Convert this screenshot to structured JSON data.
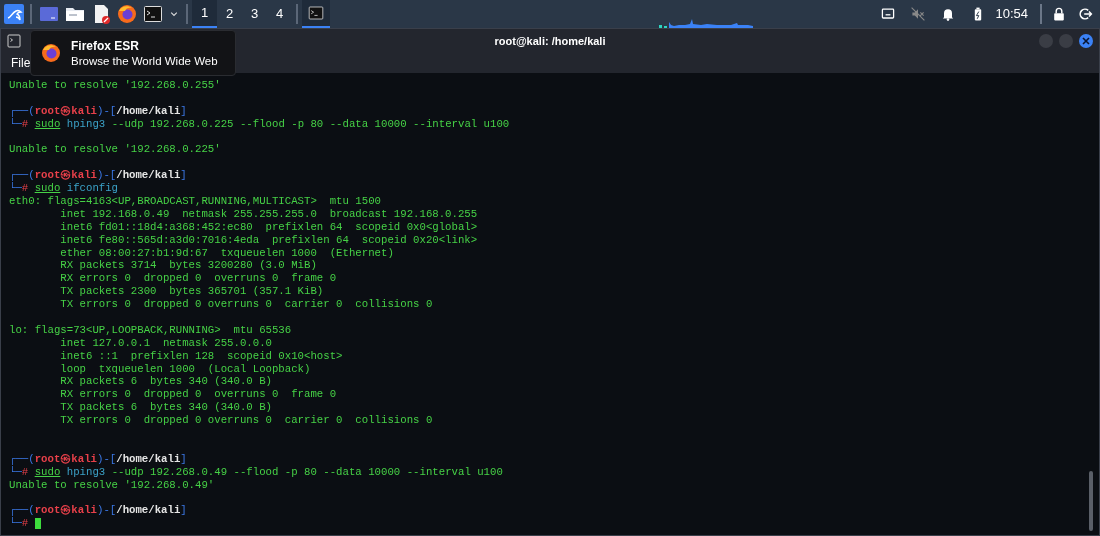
{
  "taskbar": {
    "launchers": [
      {
        "kind": "menu"
      },
      {
        "kind": "desktop"
      },
      {
        "kind": "files"
      },
      {
        "kind": "editor"
      },
      {
        "kind": "browser"
      },
      {
        "kind": "terminal"
      },
      {
        "kind": "dropdown"
      }
    ],
    "workspaces": [
      {
        "label": "1",
        "selected": true
      },
      {
        "label": "2",
        "selected": false
      },
      {
        "label": "3",
        "selected": false
      },
      {
        "label": "4",
        "selected": false
      }
    ],
    "tasks": [
      {
        "kind": "terminal",
        "selected": true
      }
    ],
    "tray": [
      {
        "kind": "display"
      },
      {
        "kind": "muted"
      },
      {
        "kind": "bell"
      },
      {
        "kind": "battery"
      }
    ],
    "clock": "10:54",
    "session": [
      {
        "kind": "lock"
      },
      {
        "kind": "logout"
      }
    ]
  },
  "window": {
    "title": "root@kali: /home/kali",
    "menu": [
      "File"
    ]
  },
  "tooltip": {
    "title": "Firefox ESR",
    "subtitle": "Browse the World Wide Web"
  },
  "terminal": {
    "lines": [
      {
        "kind": "text",
        "segments": [
          {
            "kind": "out",
            "text": "Unable to resolve '192.268.0.255'"
          }
        ]
      },
      {
        "kind": "blank"
      },
      {
        "kind": "text",
        "segments": [
          {
            "kind": "frame",
            "text": "┌──("
          },
          {
            "kind": "user",
            "text": "root㉿kali"
          },
          {
            "kind": "frame",
            "text": ")-["
          },
          {
            "kind": "path",
            "text": "/home/kali"
          },
          {
            "kind": "frame",
            "text": "]"
          }
        ]
      },
      {
        "kind": "text",
        "segments": [
          {
            "kind": "frame",
            "text": "└─"
          },
          {
            "kind": "hash",
            "text": "# "
          },
          {
            "kind": "sudo",
            "text": "sudo"
          },
          {
            "kind": "prog",
            "text": " hping3"
          },
          {
            "kind": "arg",
            "text": " --udp 192.268.0.225 --flood -p 80 --data 10000 --interval u100"
          }
        ]
      },
      {
        "kind": "blank"
      },
      {
        "kind": "text",
        "segments": [
          {
            "kind": "out",
            "text": "Unable to resolve '192.268.0.225'"
          }
        ]
      },
      {
        "kind": "blank"
      },
      {
        "kind": "text",
        "segments": [
          {
            "kind": "frame",
            "text": "┌──("
          },
          {
            "kind": "user",
            "text": "root㉿kali"
          },
          {
            "kind": "frame",
            "text": ")-["
          },
          {
            "kind": "path",
            "text": "/home/kali"
          },
          {
            "kind": "frame",
            "text": "]"
          }
        ]
      },
      {
        "kind": "text",
        "segments": [
          {
            "kind": "frame",
            "text": "└─"
          },
          {
            "kind": "hash",
            "text": "# "
          },
          {
            "kind": "sudo",
            "text": "sudo"
          },
          {
            "kind": "prog",
            "text": " ifconfig"
          }
        ]
      },
      {
        "kind": "text",
        "segments": [
          {
            "kind": "out",
            "text": "eth0: flags=4163<UP,BROADCAST,RUNNING,MULTICAST>  mtu 1500"
          }
        ]
      },
      {
        "kind": "text",
        "segments": [
          {
            "kind": "out",
            "text": "        inet 192.168.0.49  netmask 255.255.255.0  broadcast 192.168.0.255"
          }
        ]
      },
      {
        "kind": "text",
        "segments": [
          {
            "kind": "out",
            "text": "        inet6 fd01::18d4:a368:452:ec80  prefixlen 64  scopeid 0x0<global>"
          }
        ]
      },
      {
        "kind": "text",
        "segments": [
          {
            "kind": "out",
            "text": "        inet6 fe80::565d:a3d0:7016:4eda  prefixlen 64  scopeid 0x20<link>"
          }
        ]
      },
      {
        "kind": "text",
        "segments": [
          {
            "kind": "out",
            "text": "        ether 08:00:27:b1:9d:67  txqueuelen 1000  (Ethernet)"
          }
        ]
      },
      {
        "kind": "text",
        "segments": [
          {
            "kind": "out",
            "text": "        RX packets 3714  bytes 3200280 (3.0 MiB)"
          }
        ]
      },
      {
        "kind": "text",
        "segments": [
          {
            "kind": "out",
            "text": "        RX errors 0  dropped 0  overruns 0  frame 0"
          }
        ]
      },
      {
        "kind": "text",
        "segments": [
          {
            "kind": "out",
            "text": "        TX packets 2300  bytes 365701 (357.1 KiB)"
          }
        ]
      },
      {
        "kind": "text",
        "segments": [
          {
            "kind": "out",
            "text": "        TX errors 0  dropped 0 overruns 0  carrier 0  collisions 0"
          }
        ]
      },
      {
        "kind": "blank"
      },
      {
        "kind": "text",
        "segments": [
          {
            "kind": "out",
            "text": "lo: flags=73<UP,LOOPBACK,RUNNING>  mtu 65536"
          }
        ]
      },
      {
        "kind": "text",
        "segments": [
          {
            "kind": "out",
            "text": "        inet 127.0.0.1  netmask 255.0.0.0"
          }
        ]
      },
      {
        "kind": "text",
        "segments": [
          {
            "kind": "out",
            "text": "        inet6 ::1  prefixlen 128  scopeid 0x10<host>"
          }
        ]
      },
      {
        "kind": "text",
        "segments": [
          {
            "kind": "out",
            "text": "        loop  txqueuelen 1000  (Local Loopback)"
          }
        ]
      },
      {
        "kind": "text",
        "segments": [
          {
            "kind": "out",
            "text": "        RX packets 6  bytes 340 (340.0 B)"
          }
        ]
      },
      {
        "kind": "text",
        "segments": [
          {
            "kind": "out",
            "text": "        RX errors 0  dropped 0  overruns 0  frame 0"
          }
        ]
      },
      {
        "kind": "text",
        "segments": [
          {
            "kind": "out",
            "text": "        TX packets 6  bytes 340 (340.0 B)"
          }
        ]
      },
      {
        "kind": "text",
        "segments": [
          {
            "kind": "out",
            "text": "        TX errors 0  dropped 0 overruns 0  carrier 0  collisions 0"
          }
        ]
      },
      {
        "kind": "blank"
      },
      {
        "kind": "blank"
      },
      {
        "kind": "text",
        "segments": [
          {
            "kind": "frame",
            "text": "┌──("
          },
          {
            "kind": "user",
            "text": "root㉿kali"
          },
          {
            "kind": "frame",
            "text": ")-["
          },
          {
            "kind": "path",
            "text": "/home/kali"
          },
          {
            "kind": "frame",
            "text": "]"
          }
        ]
      },
      {
        "kind": "text",
        "segments": [
          {
            "kind": "frame",
            "text": "└─"
          },
          {
            "kind": "hash",
            "text": "# "
          },
          {
            "kind": "sudo",
            "text": "sudo"
          },
          {
            "kind": "prog",
            "text": " hping3"
          },
          {
            "kind": "arg",
            "text": " --udp 192.268.0.49 --flood -p 80 --data 10000 --interval u100"
          }
        ]
      },
      {
        "kind": "text",
        "segments": [
          {
            "kind": "out",
            "text": "Unable to resolve '192.268.0.49'"
          }
        ]
      },
      {
        "kind": "blank"
      },
      {
        "kind": "text",
        "segments": [
          {
            "kind": "frame",
            "text": "┌──("
          },
          {
            "kind": "user",
            "text": "root㉿kali"
          },
          {
            "kind": "frame",
            "text": ")-["
          },
          {
            "kind": "path",
            "text": "/home/kali"
          },
          {
            "kind": "frame",
            "text": "]"
          }
        ]
      },
      {
        "kind": "cursor",
        "segments": [
          {
            "kind": "frame",
            "text": "└─"
          },
          {
            "kind": "hash",
            "text": "# "
          }
        ]
      }
    ]
  }
}
